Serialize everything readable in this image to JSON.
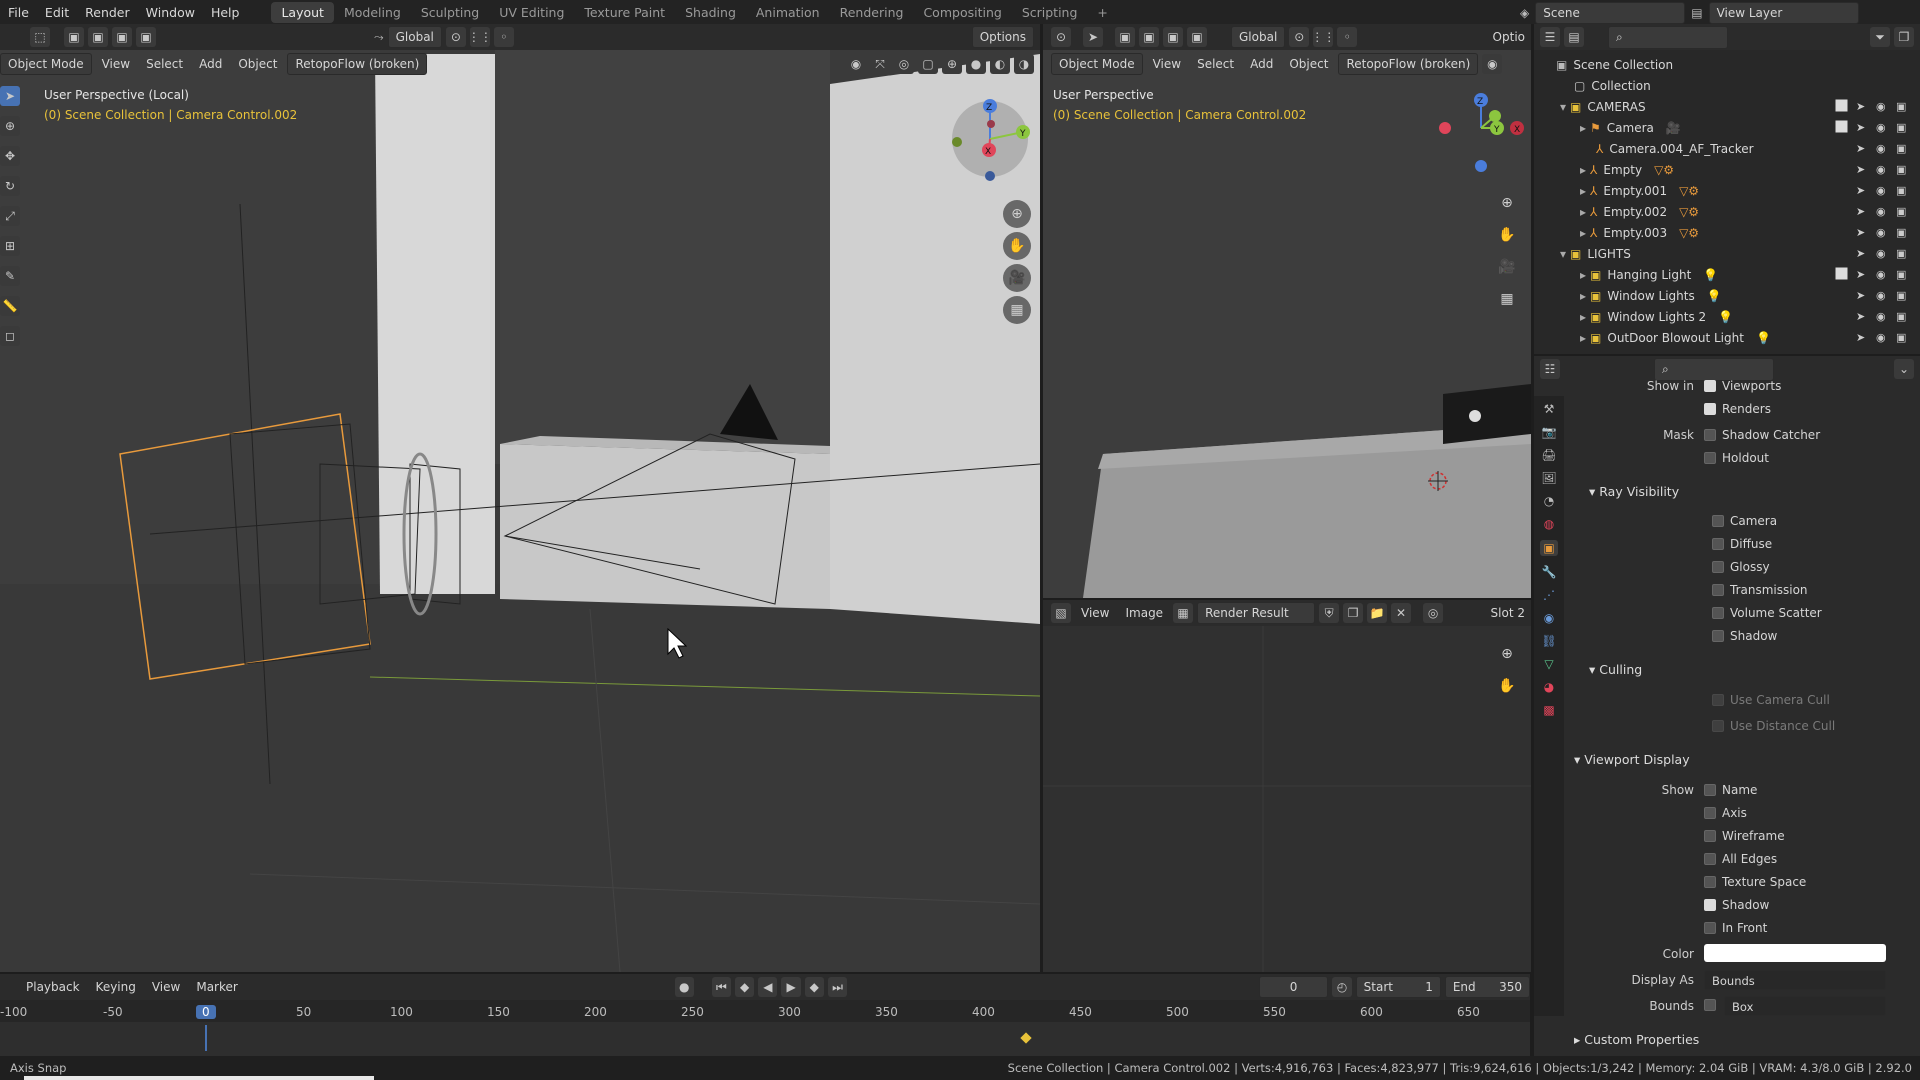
{
  "topbar": {
    "menus": [
      "File",
      "Edit",
      "Render",
      "Window",
      "Help"
    ],
    "workspaces": [
      "Layout",
      "Modeling",
      "Sculpting",
      "UV Editing",
      "Texture Paint",
      "Shading",
      "Animation",
      "Rendering",
      "Compositing",
      "Scripting"
    ],
    "active_workspace": "Layout",
    "add_tab": "+",
    "scene_label": "Scene",
    "view_layer_label": "View Layer"
  },
  "viewport_left": {
    "toolbar": {
      "transform_orientation": "Global",
      "options": "Options"
    },
    "header": {
      "mode": "Object Mode",
      "menus": [
        "View",
        "Select",
        "Add",
        "Object"
      ],
      "addon": "RetopoFlow (broken)"
    },
    "title": "User Perspective (Local)",
    "subtitle": "(0) Scene Collection | Camera Control.002"
  },
  "viewport_right": {
    "toolbar": {
      "transform_orientation": "Global",
      "options": "Optio"
    },
    "header": {
      "mode": "Object Mode",
      "menus": [
        "View",
        "Select",
        "Add",
        "Object"
      ],
      "addon": "RetopoFlow (broken)"
    },
    "title": "User Perspective",
    "subtitle": "(0) Scene Collection | Camera Control.002",
    "gizmo": {
      "z": "Z",
      "y": "Y",
      "x": "X"
    }
  },
  "image_editor": {
    "menus": [
      "View",
      "Image"
    ],
    "image_name": "Render Result",
    "slot": "Slot 2"
  },
  "outliner": {
    "root": "Scene Collection",
    "rows": [
      {
        "label": "Collection",
        "indent": 1,
        "type": "collection"
      },
      {
        "label": "CAMERAS",
        "indent": 1,
        "type": "collection",
        "expanded": true
      },
      {
        "label": "Camera",
        "indent": 2,
        "type": "object"
      },
      {
        "label": "Camera.004_AF_Tracker",
        "indent": 2,
        "type": "object"
      },
      {
        "label": "Empty",
        "indent": 2,
        "type": "object"
      },
      {
        "label": "Empty.001",
        "indent": 2,
        "type": "object"
      },
      {
        "label": "Empty.002",
        "indent": 2,
        "type": "object"
      },
      {
        "label": "Empty.003",
        "indent": 2,
        "type": "object"
      },
      {
        "label": "LIGHTS",
        "indent": 1,
        "type": "collection",
        "expanded": true
      },
      {
        "label": "Hanging Light",
        "indent": 2,
        "type": "object"
      },
      {
        "label": "Window Lights",
        "indent": 2,
        "type": "object"
      },
      {
        "label": "Window Lights 2",
        "indent": 2,
        "type": "object"
      },
      {
        "label": "OutDoor Blowout Light",
        "indent": 2,
        "type": "object"
      }
    ]
  },
  "properties": {
    "show_in_label": "Show in",
    "viewports": "Viewports",
    "renders": "Renders",
    "mask_label": "Mask",
    "shadow_catcher": "Shadow Catcher",
    "holdout": "Holdout",
    "ray_visibility": "Ray Visibility",
    "ray_items": [
      "Camera",
      "Diffuse",
      "Glossy",
      "Transmission",
      "Volume Scatter",
      "Shadow"
    ],
    "culling": "Culling",
    "culling_items": [
      "Use Camera Cull",
      "Use Distance Cull"
    ],
    "viewport_display": "Viewport Display",
    "show_label": "Show",
    "display_items": [
      {
        "label": "Name",
        "checked": false
      },
      {
        "label": "Axis",
        "checked": false
      },
      {
        "label": "Wireframe",
        "checked": false
      },
      {
        "label": "All Edges",
        "checked": false
      },
      {
        "label": "Texture Space",
        "checked": false
      },
      {
        "label": "Shadow",
        "checked": true
      },
      {
        "label": "In Front",
        "checked": false
      }
    ],
    "color_label": "Color",
    "color_value": "#ffffff",
    "display_as_label": "Display As",
    "display_as_value": "Bounds",
    "bounds_label": "Bounds",
    "bounds_value": "Box",
    "custom_properties": "Custom Properties"
  },
  "timeline": {
    "menus": [
      "Playback",
      "Keying",
      "View",
      "Marker"
    ],
    "current_frame": "0",
    "start_label": "Start",
    "start_value": "1",
    "end_label": "End",
    "end_value": "350",
    "ruler": [
      "-100",
      "-50",
      "0",
      "50",
      "100",
      "150",
      "200",
      "250",
      "300",
      "350",
      "400",
      "450",
      "500",
      "550",
      "600",
      "650"
    ]
  },
  "statusbar": {
    "left": "Axis Snap",
    "right": "Scene Collection | Camera Control.002 | Verts:4,916,763 | Faces:4,823,977 | Tris:9,624,616 | Objects:1/3,242 | Memory: 2.04 GiB | VRAM: 4.3/8.0 GiB | 2.92.0"
  },
  "colors": {
    "accent": "#4772b3",
    "selected_orange": "#e89a3c",
    "header_yellow": "#e8c23a"
  }
}
